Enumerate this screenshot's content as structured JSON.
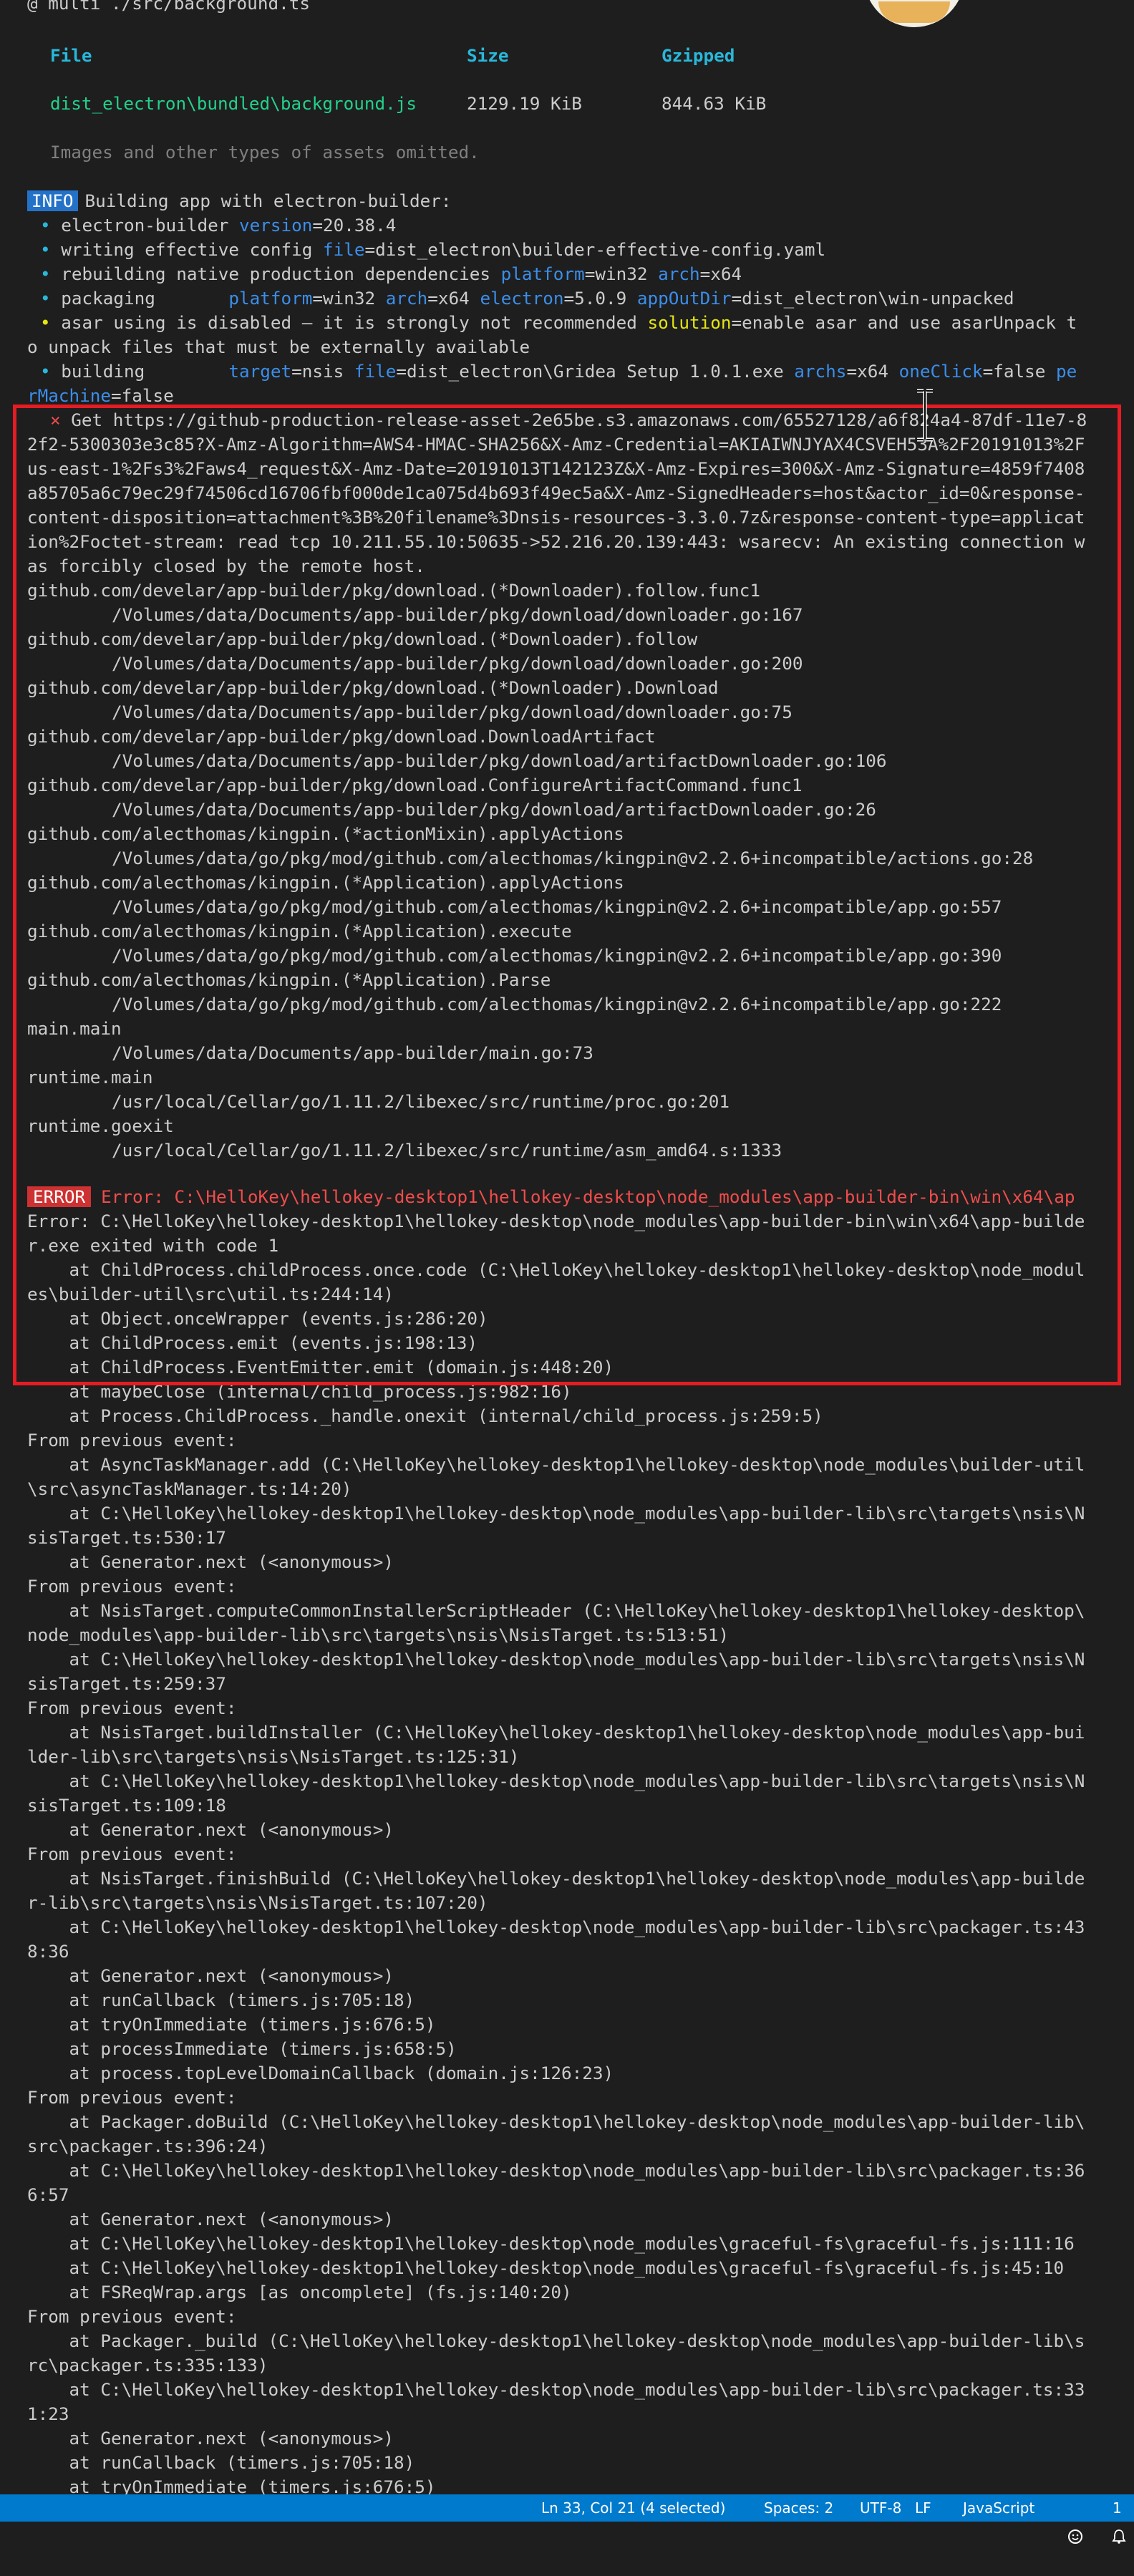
{
  "terminal": {
    "header": "@ multi ./src/background.ts",
    "table": {
      "headers": [
        "File",
        "Size",
        "Gzipped"
      ],
      "row": [
        "dist_electron\\bundled\\background.js",
        "2129.19 KiB",
        "844.63 KiB"
      ]
    },
    "assets_note": "Images and other types of assets omitted.",
    "info_badge": "INFO",
    "building_text": "Building app with electron-builder:",
    "eb": {
      "bullet": "•",
      "l1": [
        "electron-builder ",
        "version",
        "=20.38.4"
      ],
      "l2": [
        "writing effective config ",
        "file",
        "=dist_electron\\builder-effective-config.yaml"
      ],
      "l3": [
        "rebuilding native production dependencies ",
        "platform",
        "=win32 ",
        "arch",
        "=x64"
      ],
      "l4": [
        "packaging       ",
        "platform",
        "=win32 ",
        "arch",
        "=x64 ",
        "electron",
        "=5.0.9 ",
        "appOutDir",
        "=dist_electron\\win-unpacked"
      ],
      "l5": [
        "asar using is disabled — it is strongly not recommended ",
        "solution",
        "=enable asar and use asarUnpack t"
      ],
      "l5b": "o unpack files that must be externally available",
      "l6": [
        "building        ",
        "target",
        "=nsis ",
        "file",
        "=dist_electron\\Gridea Setup 1.0.1.exe ",
        "archs",
        "=x64 ",
        "oneClick",
        "=false ",
        "pe"
      ],
      "l6b": [
        "rMachine",
        "=false"
      ]
    },
    "fail": {
      "mark": "×",
      "lines": [
        "Get https://github-production-release-asset-2e65be.s3.amazonaws.com/65527128/a6f824a4-87df-11e7-8",
        "2f2-5300303e3c85?X-Amz-Algorithm=AWS4-HMAC-SHA256&X-Amz-Credential=AKIAIWNJYAX4CSVEH53A%2F20191013%2F",
        "us-east-1%2Fs3%2Faws4_request&X-Amz-Date=20191013T142123Z&X-Amz-Expires=300&X-Amz-Signature=4859f7408",
        "a85705a6c79ec29f74506cd16706fbf000de1ca075d4b693f49ec5a&X-Amz-SignedHeaders=host&actor_id=0&response-",
        "content-disposition=attachment%3B%20filename%3Dnsis-resources-3.3.0.7z&response-content-type=applicat",
        "ion%2Foctet-stream: read tcp 10.211.55.10:50635->52.216.20.139:443: wsarecv: An existing connection w",
        "as forcibly closed by the remote host."
      ]
    },
    "stack": [
      {
        "text": "github.com/develar/app-builder/pkg/download.(*Downloader).follow.func1",
        "indent": false
      },
      {
        "text": "/Volumes/data/Documents/app-builder/pkg/download/downloader.go:167",
        "indent": true
      },
      {
        "text": "github.com/develar/app-builder/pkg/download.(*Downloader).follow",
        "indent": false
      },
      {
        "text": "/Volumes/data/Documents/app-builder/pkg/download/downloader.go:200",
        "indent": true
      },
      {
        "text": "github.com/develar/app-builder/pkg/download.(*Downloader).Download",
        "indent": false
      },
      {
        "text": "/Volumes/data/Documents/app-builder/pkg/download/downloader.go:75",
        "indent": true
      },
      {
        "text": "github.com/develar/app-builder/pkg/download.DownloadArtifact",
        "indent": false
      },
      {
        "text": "/Volumes/data/Documents/app-builder/pkg/download/artifactDownloader.go:106",
        "indent": true
      },
      {
        "text": "github.com/develar/app-builder/pkg/download.ConfigureArtifactCommand.func1",
        "indent": false
      },
      {
        "text": "/Volumes/data/Documents/app-builder/pkg/download/artifactDownloader.go:26",
        "indent": true
      },
      {
        "text": "github.com/alecthomas/kingpin.(*actionMixin).applyActions",
        "indent": false
      },
      {
        "text": "/Volumes/data/go/pkg/mod/github.com/alecthomas/kingpin@v2.2.6+incompatible/actions.go:28",
        "indent": true
      },
      {
        "text": "github.com/alecthomas/kingpin.(*Application).applyActions",
        "indent": false
      },
      {
        "text": "/Volumes/data/go/pkg/mod/github.com/alecthomas/kingpin@v2.2.6+incompatible/app.go:557",
        "indent": true
      },
      {
        "text": "github.com/alecthomas/kingpin.(*Application).execute",
        "indent": false
      },
      {
        "text": "/Volumes/data/go/pkg/mod/github.com/alecthomas/kingpin@v2.2.6+incompatible/app.go:390",
        "indent": true
      },
      {
        "text": "github.com/alecthomas/kingpin.(*Application).Parse",
        "indent": false
      },
      {
        "text": "/Volumes/data/go/pkg/mod/github.com/alecthomas/kingpin@v2.2.6+incompatible/app.go:222",
        "indent": true
      },
      {
        "text": "main.main",
        "indent": false
      },
      {
        "text": "/Volumes/data/Documents/app-builder/main.go:73",
        "indent": true
      },
      {
        "text": "runtime.main",
        "indent": false
      },
      {
        "text": "/usr/local/Cellar/go/1.11.2/libexec/src/runtime/proc.go:201",
        "indent": true
      },
      {
        "text": "runtime.goexit",
        "indent": false
      },
      {
        "text": "/usr/local/Cellar/go/1.11.2/libexec/src/runtime/asm_amd64.s:1333",
        "indent": true
      }
    ],
    "error_badge": "ERROR",
    "error_title": "Error: C:\\HelloKey\\hellokey-desktop1\\hellokey-desktop\\node_modules\\app-builder-bin\\win\\x64\\ap",
    "trace": [
      "Error: C:\\HelloKey\\hellokey-desktop1\\hellokey-desktop\\node_modules\\app-builder-bin\\win\\x64\\app-builde",
      "r.exe exited with code 1",
      "    at ChildProcess.childProcess.once.code (C:\\HelloKey\\hellokey-desktop1\\hellokey-desktop\\node_modul",
      "es\\builder-util\\src\\util.ts:244:14)",
      "    at Object.onceWrapper (events.js:286:20)",
      "    at ChildProcess.emit (events.js:198:13)",
      "    at ChildProcess.EventEmitter.emit (domain.js:448:20)",
      "    at maybeClose (internal/child_process.js:982:16)",
      "    at Process.ChildProcess._handle.onexit (internal/child_process.js:259:5)",
      "From previous event:",
      "    at AsyncTaskManager.add (C:\\HelloKey\\hellokey-desktop1\\hellokey-desktop\\node_modules\\builder-util",
      "\\src\\asyncTaskManager.ts:14:20)",
      "    at C:\\HelloKey\\hellokey-desktop1\\hellokey-desktop\\node_modules\\app-builder-lib\\src\\targets\\nsis\\N",
      "sisTarget.ts:530:17",
      "    at Generator.next (<anonymous>)",
      "From previous event:",
      "    at NsisTarget.computeCommonInstallerScriptHeader (C:\\HelloKey\\hellokey-desktop1\\hellokey-desktop\\",
      "node_modules\\app-builder-lib\\src\\targets\\nsis\\NsisTarget.ts:513:51)",
      "    at C:\\HelloKey\\hellokey-desktop1\\hellokey-desktop\\node_modules\\app-builder-lib\\src\\targets\\nsis\\N",
      "sisTarget.ts:259:37",
      "From previous event:",
      "    at NsisTarget.buildInstaller (C:\\HelloKey\\hellokey-desktop1\\hellokey-desktop\\node_modules\\app-bui",
      "lder-lib\\src\\targets\\nsis\\NsisTarget.ts:125:31)",
      "    at C:\\HelloKey\\hellokey-desktop1\\hellokey-desktop\\node_modules\\app-builder-lib\\src\\targets\\nsis\\N",
      "sisTarget.ts:109:18",
      "    at Generator.next (<anonymous>)",
      "From previous event:",
      "    at NsisTarget.finishBuild (C:\\HelloKey\\hellokey-desktop1\\hellokey-desktop\\node_modules\\app-builde",
      "r-lib\\src\\targets\\nsis\\NsisTarget.ts:107:20)",
      "    at C:\\HelloKey\\hellokey-desktop1\\hellokey-desktop\\node_modules\\app-builder-lib\\src\\packager.ts:43",
      "8:36",
      "    at Generator.next (<anonymous>)",
      "    at runCallback (timers.js:705:18)",
      "    at tryOnImmediate (timers.js:676:5)",
      "    at processImmediate (timers.js:658:5)",
      "    at process.topLevelDomainCallback (domain.js:126:23)",
      "From previous event:",
      "    at Packager.doBuild (C:\\HelloKey\\hellokey-desktop1\\hellokey-desktop\\node_modules\\app-builder-lib\\",
      "src\\packager.ts:396:24)",
      "    at C:\\HelloKey\\hellokey-desktop1\\hellokey-desktop\\node_modules\\app-builder-lib\\src\\packager.ts:36",
      "6:57",
      "    at Generator.next (<anonymous>)",
      "    at C:\\HelloKey\\hellokey-desktop1\\hellokey-desktop\\node_modules\\graceful-fs\\graceful-fs.js:111:16",
      "    at C:\\HelloKey\\hellokey-desktop1\\hellokey-desktop\\node_modules\\graceful-fs\\graceful-fs.js:45:10",
      "    at FSReqWrap.args [as oncomplete] (fs.js:140:20)",
      "From previous event:",
      "    at Packager._build (C:\\HelloKey\\hellokey-desktop1\\hellokey-desktop\\node_modules\\app-builder-lib\\s",
      "rc\\packager.ts:335:133)",
      "    at C:\\HelloKey\\hellokey-desktop1\\hellokey-desktop\\node_modules\\app-builder-lib\\src\\packager.ts:33",
      "1:23",
      "    at Generator.next (<anonymous>)",
      "    at runCallback (timers.js:705:18)",
      "    at tryOnImmediate (timers.js:676:5)"
    ]
  },
  "statusbar": {
    "cursor": "Ln 33, Col 21 (4 selected)",
    "spaces": "Spaces: 2",
    "encoding": "UTF-8",
    "eol": "LF",
    "language": "JavaScript",
    "feedback_icon": "smiley-icon",
    "bell_icon": "bell-icon",
    "notifications": "1"
  },
  "colors": {
    "background": "#1e1e1e",
    "text": "#cccccc",
    "cyan": "#29b8db",
    "green": "#23d18b",
    "blue": "#3b8eea",
    "yellow": "#e5e510",
    "red": "#f14c4c",
    "info_badge": "#2472c8",
    "error_badge": "#cd3131",
    "highlight_box": "#e51c23",
    "statusbar": "#007acc"
  }
}
